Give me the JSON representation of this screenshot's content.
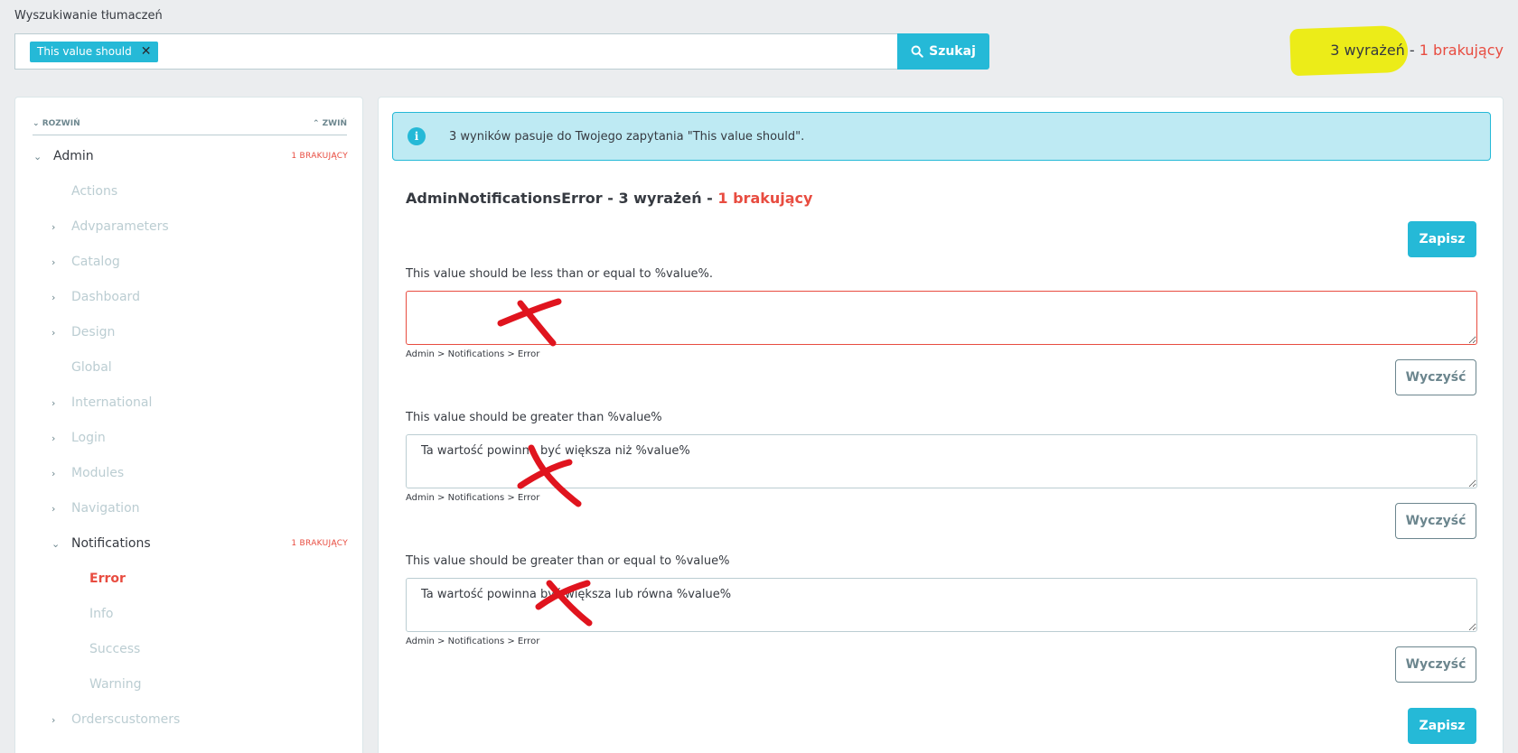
{
  "header": {
    "label": "Wyszukiwanie tłumaczeń",
    "search_tag": "This value should",
    "search_button": "Szukaj",
    "summary_count": "3 wyrażeń",
    "summary_sep": " - ",
    "summary_missing": "1 brakujący"
  },
  "sidebar": {
    "expand": "ROZWIŃ",
    "collapse": "ZWIŃ",
    "items": [
      {
        "label": "Admin",
        "badge": "1 BRAKUJĄCY"
      },
      {
        "label": "Actions"
      },
      {
        "label": "Advparameters"
      },
      {
        "label": "Catalog"
      },
      {
        "label": "Dashboard"
      },
      {
        "label": "Design"
      },
      {
        "label": "Global"
      },
      {
        "label": "International"
      },
      {
        "label": "Login"
      },
      {
        "label": "Modules"
      },
      {
        "label": "Navigation"
      },
      {
        "label": "Notifications",
        "badge": "1 BRAKUJĄCY"
      },
      {
        "label": "Error"
      },
      {
        "label": "Info"
      },
      {
        "label": "Success"
      },
      {
        "label": "Warning"
      },
      {
        "label": "Orderscustomers"
      }
    ]
  },
  "main": {
    "alert": "3 wyników pasuje do Twojego zapytania \"This value should\".",
    "domain_title": "AdminNotificationsError - 3 wyrażeń - ",
    "domain_missing": "1 brakujący",
    "save_label": "Zapisz",
    "clear_label": "Wyczyść",
    "entries": [
      {
        "label": "This value should be less than or equal to %value%.",
        "value": "",
        "crumb": "Admin > Notifications > Error"
      },
      {
        "label": "This value should be greater than %value%",
        "value": "Ta wartość powinna być większa niż %value%",
        "crumb": "Admin > Notifications > Error"
      },
      {
        "label": "This value should be greater than or equal to %value%",
        "value": "Ta wartość powinna być większa lub równa %value%",
        "crumb": "Admin > Notifications > Error"
      }
    ]
  },
  "colors": {
    "accent": "#25b9d7",
    "missing": "#e84c40",
    "highlight": "#ecec18",
    "annotation": "#e0141e"
  }
}
